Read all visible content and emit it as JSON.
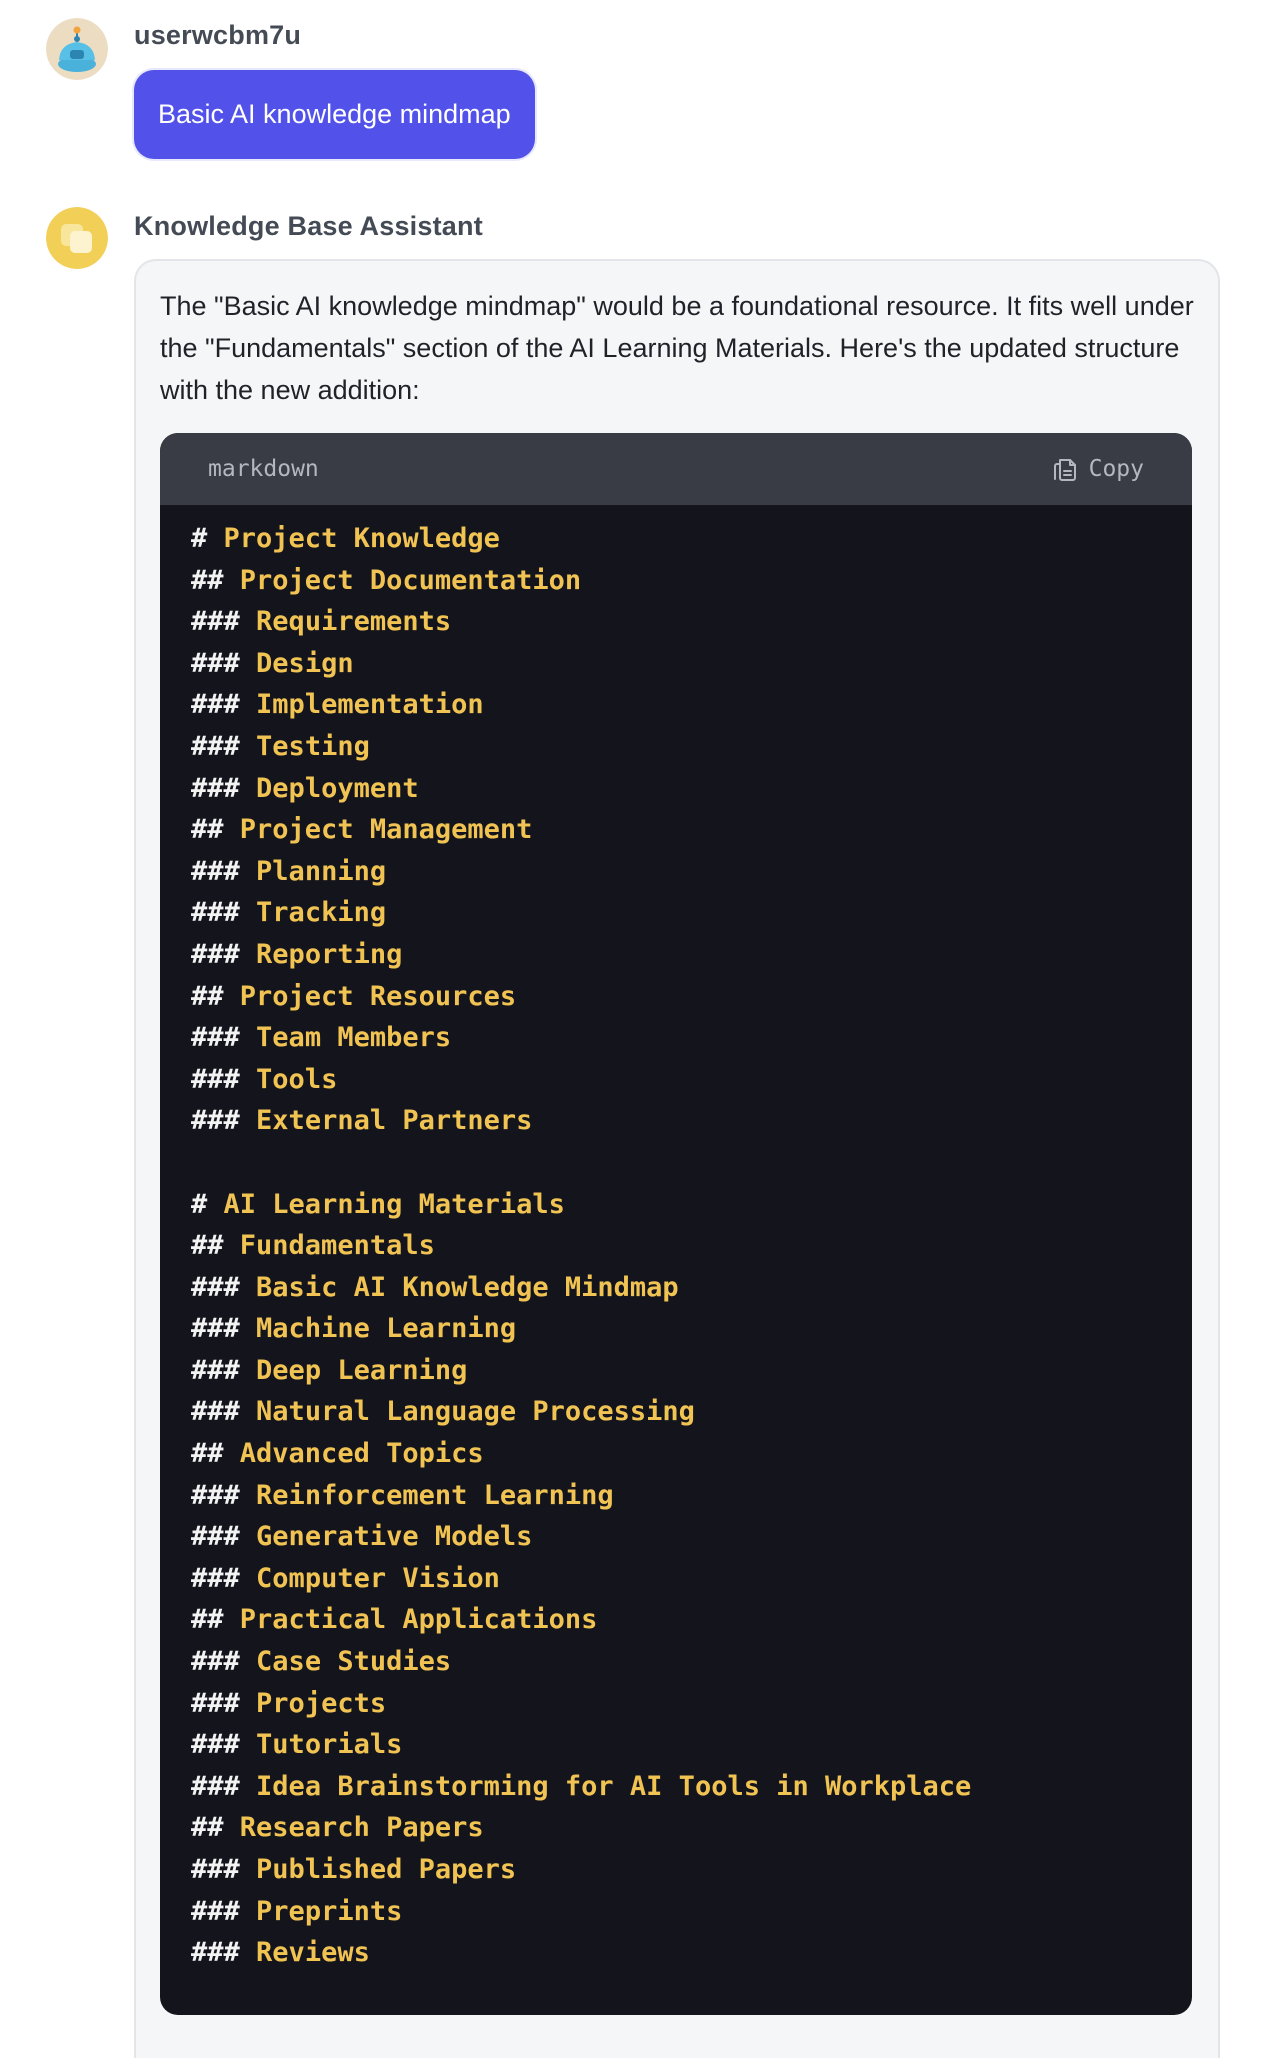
{
  "user_message": {
    "username": "userwcbm7u",
    "text": "Basic AI knowledge mindmap",
    "avatar_icon": "robot-avatar-icon"
  },
  "assistant_message": {
    "name": "Knowledge Base Assistant",
    "avatar_icon": "assistant-logo-icon",
    "intro": "The \"Basic AI knowledge mindmap\" would be a foundational resource. It fits well under the \"Fundamentals\" section of the AI Learning Materials. Here's the updated structure with the new addition:",
    "code_block": {
      "language": "markdown",
      "copy_label": "Copy",
      "lines": [
        {
          "hashes": "#",
          "text": "Project Knowledge"
        },
        {
          "hashes": "##",
          "text": "Project Documentation"
        },
        {
          "hashes": "###",
          "text": "Requirements"
        },
        {
          "hashes": "###",
          "text": "Design"
        },
        {
          "hashes": "###",
          "text": "Implementation"
        },
        {
          "hashes": "###",
          "text": "Testing"
        },
        {
          "hashes": "###",
          "text": "Deployment"
        },
        {
          "hashes": "##",
          "text": "Project Management"
        },
        {
          "hashes": "###",
          "text": "Planning"
        },
        {
          "hashes": "###",
          "text": "Tracking"
        },
        {
          "hashes": "###",
          "text": "Reporting"
        },
        {
          "hashes": "##",
          "text": "Project Resources"
        },
        {
          "hashes": "###",
          "text": "Team Members"
        },
        {
          "hashes": "###",
          "text": "Tools"
        },
        {
          "hashes": "###",
          "text": "External Partners"
        },
        {
          "hashes": "",
          "text": ""
        },
        {
          "hashes": "#",
          "text": "AI Learning Materials"
        },
        {
          "hashes": "##",
          "text": "Fundamentals"
        },
        {
          "hashes": "###",
          "text": "Basic AI Knowledge Mindmap"
        },
        {
          "hashes": "###",
          "text": "Machine Learning"
        },
        {
          "hashes": "###",
          "text": "Deep Learning"
        },
        {
          "hashes": "###",
          "text": "Natural Language Processing"
        },
        {
          "hashes": "##",
          "text": "Advanced Topics"
        },
        {
          "hashes": "###",
          "text": "Reinforcement Learning"
        },
        {
          "hashes": "###",
          "text": "Generative Models"
        },
        {
          "hashes": "###",
          "text": "Computer Vision"
        },
        {
          "hashes": "##",
          "text": "Practical Applications"
        },
        {
          "hashes": "###",
          "text": "Case Studies"
        },
        {
          "hashes": "###",
          "text": "Projects"
        },
        {
          "hashes": "###",
          "text": "Tutorials"
        },
        {
          "hashes": "###",
          "text": "Idea Brainstorming for AI Tools in Workplace"
        },
        {
          "hashes": "##",
          "text": "Research Papers"
        },
        {
          "hashes": "###",
          "text": "Published Papers"
        },
        {
          "hashes": "###",
          "text": "Preprints"
        },
        {
          "hashes": "###",
          "text": "Reviews"
        }
      ]
    }
  },
  "colors": {
    "user_bubble": "#5252ea",
    "code_background": "#14141c",
    "code_header": "#3a3c45",
    "code_text": "#f0c353",
    "code_hash": "#f3f3f3"
  }
}
